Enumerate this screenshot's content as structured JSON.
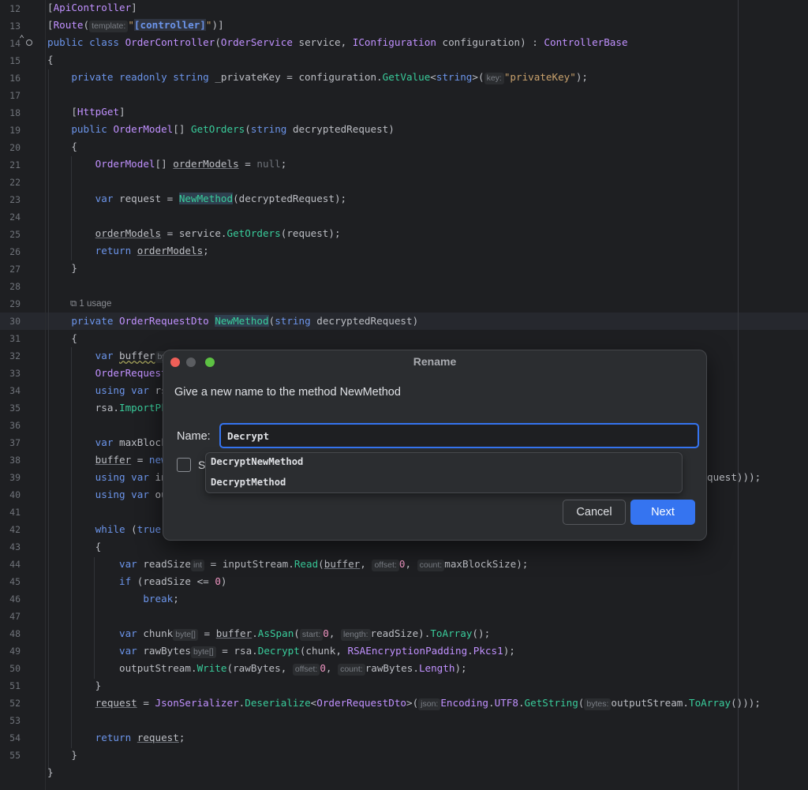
{
  "editor": {
    "line_numbers": [
      "12",
      "13",
      "14",
      "15",
      "16",
      "17",
      "18",
      "19",
      "20",
      "21",
      "22",
      "23",
      "24",
      "25",
      "26",
      "27",
      "28",
      "29",
      "30",
      "31",
      "32",
      "33",
      "34",
      "35",
      "36",
      "37",
      "38",
      "39",
      "40",
      "41",
      "42",
      "43",
      "44",
      "45",
      "46",
      "47",
      "48",
      "49",
      "50",
      "51",
      "52",
      "53",
      "54",
      "55"
    ],
    "usage_hint": "1 usage",
    "hints": {
      "template": "template:",
      "key": "key:",
      "by": "by",
      "int": "int",
      "offset": "offset:",
      "count": "count:",
      "byte_arr": "byte[]",
      "start": "start:",
      "length": "length:",
      "json": "json:",
      "bytes": "bytes:"
    }
  },
  "dialog": {
    "title": "Rename",
    "message": "Give a new name to the method NewMethod",
    "name_label": "Name:",
    "name_value": "Decrypt",
    "checkbox_label": "S",
    "suggestions": [
      "DecryptNewMethod",
      "DecryptMethod"
    ],
    "cancel_label": "Cancel",
    "next_label": "Next"
  },
  "colors": {
    "accent": "#3574f0",
    "background": "#1e1f22",
    "dialog_bg": "#2b2d30"
  }
}
